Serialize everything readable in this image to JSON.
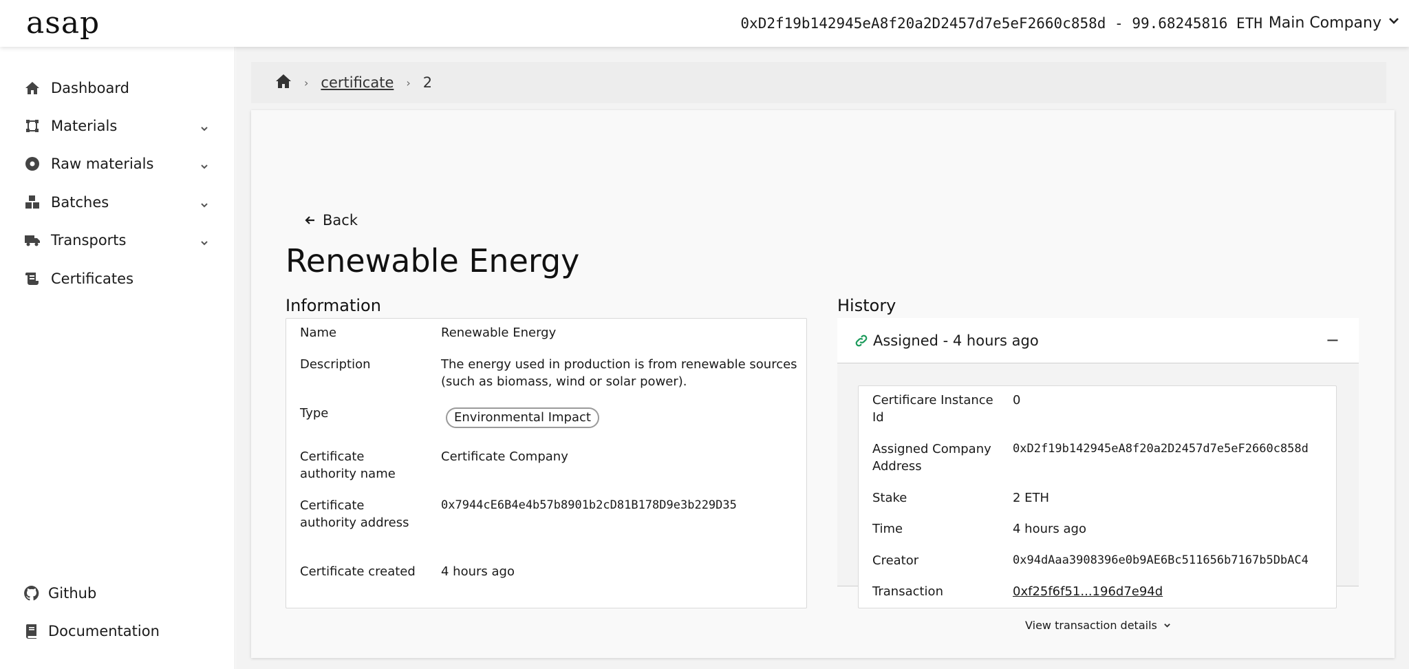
{
  "header": {
    "logo": "asap",
    "wallet": "0xD2f19b142945eA8f20a2D2457d7e5eF2660c858d - 99.68245816 ETH",
    "company": "Main Company"
  },
  "sidebar": {
    "items": [
      {
        "label": "Dashboard",
        "icon": "home-icon"
      },
      {
        "label": "Materials",
        "icon": "materials-icon"
      },
      {
        "label": "Raw materials",
        "icon": "raw-materials-icon"
      },
      {
        "label": "Batches",
        "icon": "boxes-icon"
      },
      {
        "label": "Transports",
        "icon": "truck-icon"
      },
      {
        "label": "Certificates",
        "icon": "scroll-icon"
      }
    ],
    "bottom": [
      {
        "label": "Github",
        "icon": "github-icon"
      },
      {
        "label": "Documentation",
        "icon": "book-icon"
      }
    ]
  },
  "breadcrumb": {
    "items": [
      "certificate",
      "2"
    ]
  },
  "page": {
    "back_label": "Back",
    "title": "Renewable Energy"
  },
  "information": {
    "title": "Information",
    "rows": [
      {
        "key": "Name",
        "value": "Renewable Energy"
      },
      {
        "key": "Description",
        "value": "The energy used in production is from renewable sources (such as biomass, wind or solar power)."
      },
      {
        "key": "Type",
        "value": "Environmental Impact"
      },
      {
        "key": "Certificate authority name",
        "value": "Certificate Company"
      },
      {
        "key": "Certificate authority address",
        "value": "0x7944cE6B4e4b57b8901b2cD81B178D9e3b229D35"
      },
      {
        "key": "Certificate created",
        "value": "4 hours ago"
      }
    ]
  },
  "history": {
    "title": "History",
    "event": "Assigned - 4 hours ago",
    "collapse": "−",
    "rows": [
      {
        "key": "Certificare Instance Id",
        "value": "0"
      },
      {
        "key": "Assigned Company Address",
        "value": "0xD2f19b142945eA8f20a2D2457d7e5eF2660c858d"
      },
      {
        "key": "Stake",
        "value": "2 ETH"
      },
      {
        "key": "Time",
        "value": "4 hours ago"
      },
      {
        "key": "Creator",
        "value": "0x94dAaa3908396e0b9AE6Bc511656b7167b5DbAC4"
      },
      {
        "key": "Transaction",
        "value": "0xf25f6f51...196d7e94d"
      }
    ],
    "view_details": "View transaction details"
  }
}
